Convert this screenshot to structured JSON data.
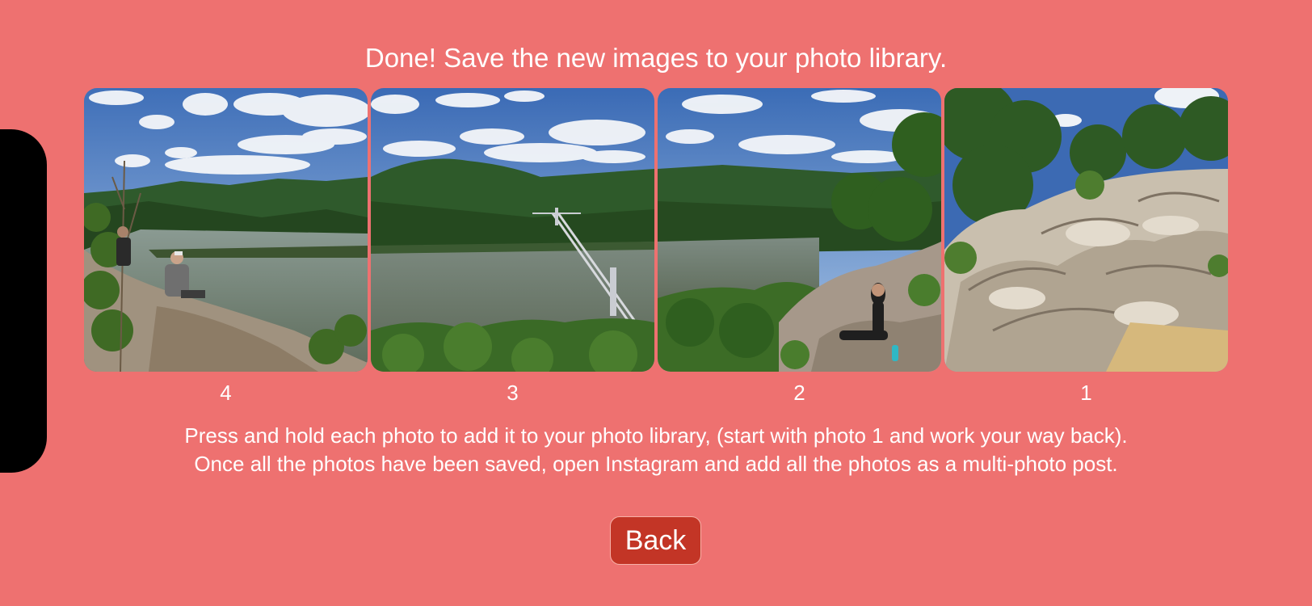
{
  "title": "Done! Save the new images to your photo library.",
  "photos": [
    {
      "number": "4",
      "description": "Left slice: hikers sitting on rocks above the river"
    },
    {
      "number": "3",
      "description": "Middle slice: suspension bridge over the river"
    },
    {
      "number": "2",
      "description": "Middle slice: woman sitting on a rocky ledge"
    },
    {
      "number": "1",
      "description": "Right slice: rocky outcrop and trees"
    }
  ],
  "instructions": {
    "line1": "Press and hold each photo to add it to your photo library, (start with photo 1 and work your way back).",
    "line2": "Once all the photos have been saved, open Instagram and add all the photos as a multi-photo post."
  },
  "back_button": {
    "label": "Back"
  },
  "colors": {
    "background": "#EE7170",
    "button": "#C33526",
    "text": "#FFFFFF"
  }
}
